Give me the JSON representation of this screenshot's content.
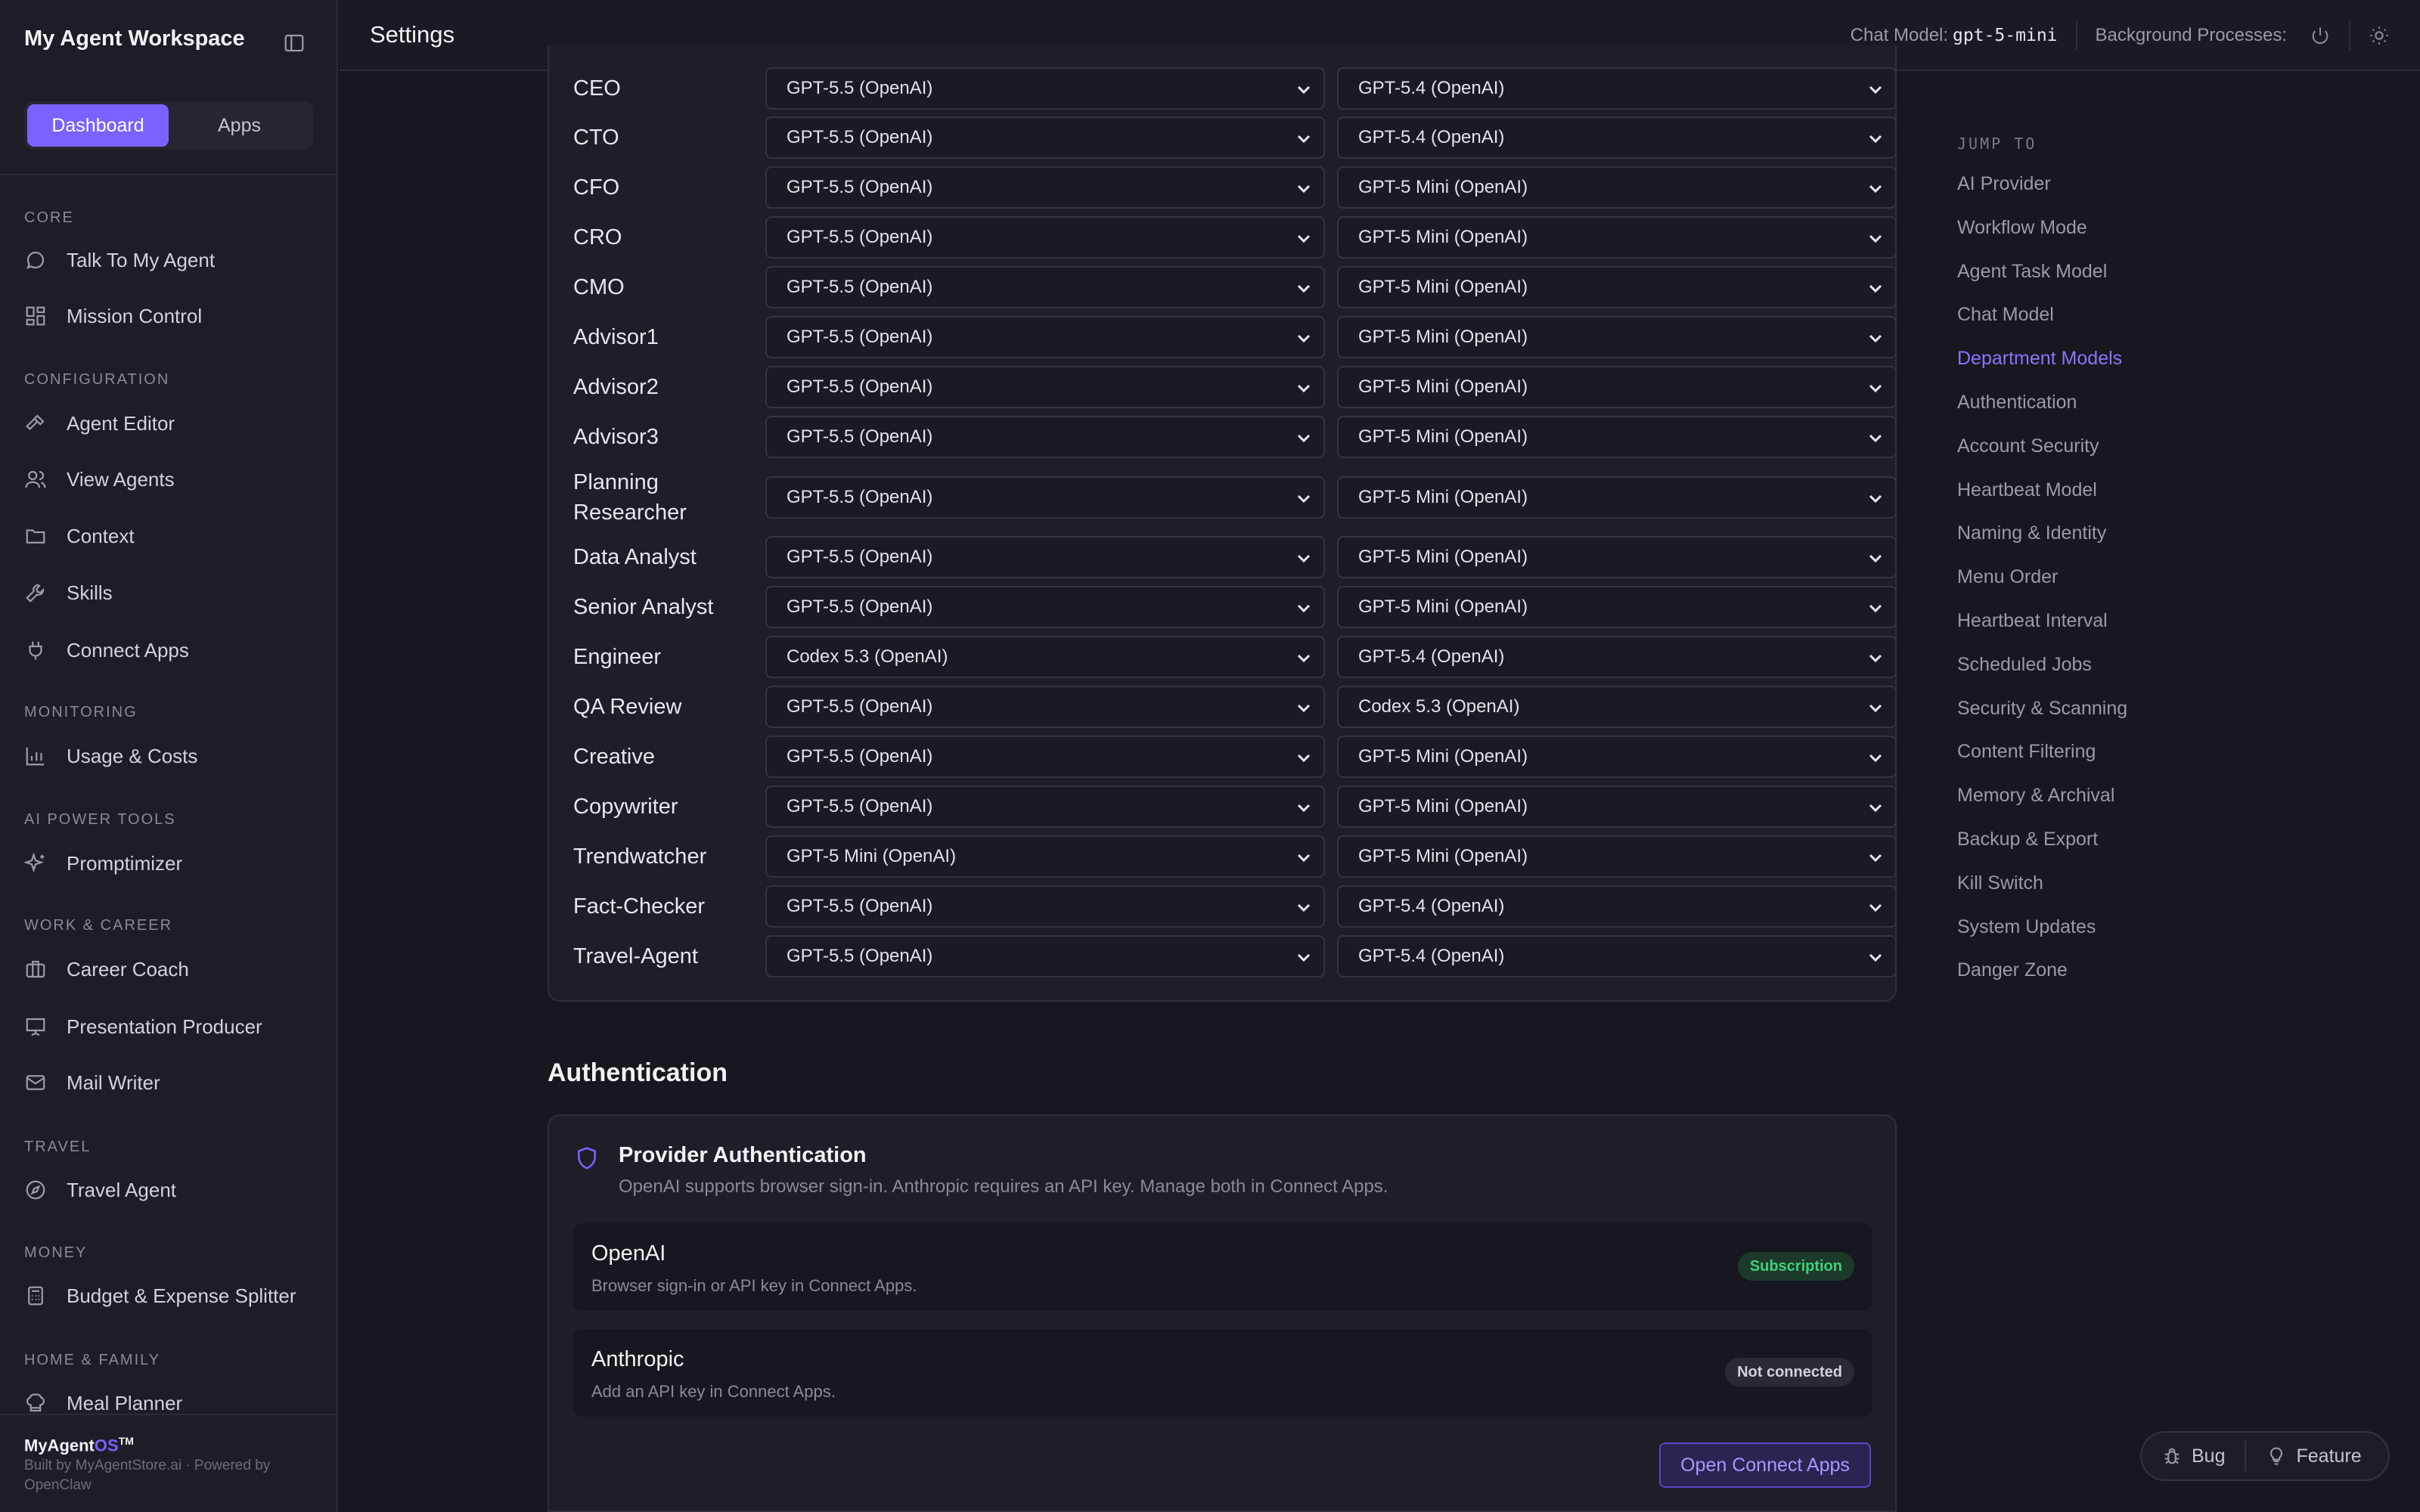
{
  "sidebar": {
    "workspace_title": "My Agent Workspace",
    "tabs": [
      "Dashboard",
      "Apps"
    ],
    "sections": [
      {
        "label": "CORE",
        "items": [
          {
            "label": "Talk To My Agent",
            "icon": "chat-bubble-icon"
          },
          {
            "label": "Mission Control",
            "icon": "grid-icon"
          }
        ]
      },
      {
        "label": "CONFIGURATION",
        "items": [
          {
            "label": "Agent Editor",
            "icon": "hammer-icon"
          },
          {
            "label": "View Agents",
            "icon": "users-icon"
          },
          {
            "label": "Context",
            "icon": "folder-icon"
          },
          {
            "label": "Skills",
            "icon": "wrench-icon"
          },
          {
            "label": "Connect Apps",
            "icon": "plug-icon"
          }
        ]
      },
      {
        "label": "MONITORING",
        "items": [
          {
            "label": "Usage & Costs",
            "icon": "bar-chart-icon"
          }
        ]
      },
      {
        "label": "AI POWER TOOLS",
        "items": [
          {
            "label": "Promptimizer",
            "icon": "sparkles-icon"
          }
        ]
      },
      {
        "label": "WORK & CAREER",
        "items": [
          {
            "label": "Career Coach",
            "icon": "briefcase-icon"
          },
          {
            "label": "Presentation Producer",
            "icon": "presentation-icon"
          },
          {
            "label": "Mail Writer",
            "icon": "mail-icon"
          }
        ]
      },
      {
        "label": "TRAVEL",
        "items": [
          {
            "label": "Travel Agent",
            "icon": "compass-icon"
          }
        ]
      },
      {
        "label": "MONEY",
        "items": [
          {
            "label": "Budget & Expense Splitter",
            "icon": "calculator-icon"
          }
        ]
      },
      {
        "label": "HOME & FAMILY",
        "items": [
          {
            "label": "Meal Planner",
            "icon": "chef-hat-icon"
          }
        ]
      }
    ],
    "brand": {
      "name": "MyAgent",
      "suffix": "OS",
      "tm": "TM"
    },
    "brand_sub": "Built by MyAgentStore.ai · Powered by OpenClaw"
  },
  "header": {
    "title": "Settings",
    "chat_model_label": "Chat Model:",
    "chat_model_value": "gpt-5-mini",
    "background_label": "Background Processes:"
  },
  "departments": [
    {
      "name": "CEO",
      "primary": "GPT-5.5 (OpenAI)",
      "secondary": "GPT-5.4 (OpenAI)"
    },
    {
      "name": "CTO",
      "primary": "GPT-5.5 (OpenAI)",
      "secondary": "GPT-5.4 (OpenAI)"
    },
    {
      "name": "CFO",
      "primary": "GPT-5.5 (OpenAI)",
      "secondary": "GPT-5 Mini (OpenAI)"
    },
    {
      "name": "CRO",
      "primary": "GPT-5.5 (OpenAI)",
      "secondary": "GPT-5 Mini (OpenAI)"
    },
    {
      "name": "CMO",
      "primary": "GPT-5.5 (OpenAI)",
      "secondary": "GPT-5 Mini (OpenAI)"
    },
    {
      "name": "Advisor1",
      "primary": "GPT-5.5 (OpenAI)",
      "secondary": "GPT-5 Mini (OpenAI)"
    },
    {
      "name": "Advisor2",
      "primary": "GPT-5.5 (OpenAI)",
      "secondary": "GPT-5 Mini (OpenAI)"
    },
    {
      "name": "Advisor3",
      "primary": "GPT-5.5 (OpenAI)",
      "secondary": "GPT-5 Mini (OpenAI)"
    },
    {
      "name": "Planning Researcher",
      "primary": "GPT-5.5 (OpenAI)",
      "secondary": "GPT-5 Mini (OpenAI)"
    },
    {
      "name": "Data Analyst",
      "primary": "GPT-5.5 (OpenAI)",
      "secondary": "GPT-5 Mini (OpenAI)"
    },
    {
      "name": "Senior Analyst",
      "primary": "GPT-5.5 (OpenAI)",
      "secondary": "GPT-5 Mini (OpenAI)"
    },
    {
      "name": "Engineer",
      "primary": "Codex 5.3 (OpenAI)",
      "secondary": "GPT-5.4 (OpenAI)"
    },
    {
      "name": "QA Review",
      "primary": "GPT-5.5 (OpenAI)",
      "secondary": "Codex 5.3 (OpenAI)"
    },
    {
      "name": "Creative",
      "primary": "GPT-5.5 (OpenAI)",
      "secondary": "GPT-5 Mini (OpenAI)"
    },
    {
      "name": "Copywriter",
      "primary": "GPT-5.5 (OpenAI)",
      "secondary": "GPT-5 Mini (OpenAI)"
    },
    {
      "name": "Trendwatcher",
      "primary": "GPT-5 Mini (OpenAI)",
      "secondary": "GPT-5 Mini (OpenAI)"
    },
    {
      "name": "Fact-Checker",
      "primary": "GPT-5.5 (OpenAI)",
      "secondary": "GPT-5.4 (OpenAI)"
    },
    {
      "name": "Travel-Agent",
      "primary": "GPT-5.5 (OpenAI)",
      "secondary": "GPT-5.4 (OpenAI)"
    }
  ],
  "authentication": {
    "heading": "Authentication",
    "card_title": "Provider Authentication",
    "card_desc": "OpenAI supports browser sign-in. Anthropic requires an API key. Manage both in Connect Apps.",
    "providers": [
      {
        "name": "OpenAI",
        "desc": "Browser sign-in or API key in Connect Apps.",
        "status": "Subscription",
        "status_color": "#3ed07a"
      },
      {
        "name": "Anthropic",
        "desc": "Add an API key in Connect Apps.",
        "status": "Not connected",
        "status_color": "#d2d2dc"
      }
    ],
    "button": "Open Connect Apps"
  },
  "jump_to": {
    "heading": "JUMP TO",
    "active": "Department Models",
    "links": [
      "AI Provider",
      "Workflow Mode",
      "Agent Task Model",
      "Chat Model",
      "Department Models",
      "Authentication",
      "Account Security",
      "Heartbeat Model",
      "Naming & Identity",
      "Menu Order",
      "Heartbeat Interval",
      "Scheduled Jobs",
      "Security & Scanning",
      "Content Filtering",
      "Memory & Archival",
      "Backup & Export",
      "Kill Switch",
      "System Updates",
      "Danger Zone"
    ]
  },
  "feedback": {
    "bug": "Bug",
    "feature": "Feature"
  },
  "colors": {
    "accent": "#7b61ff",
    "background": "#17171f",
    "panel": "#1e1e28"
  }
}
